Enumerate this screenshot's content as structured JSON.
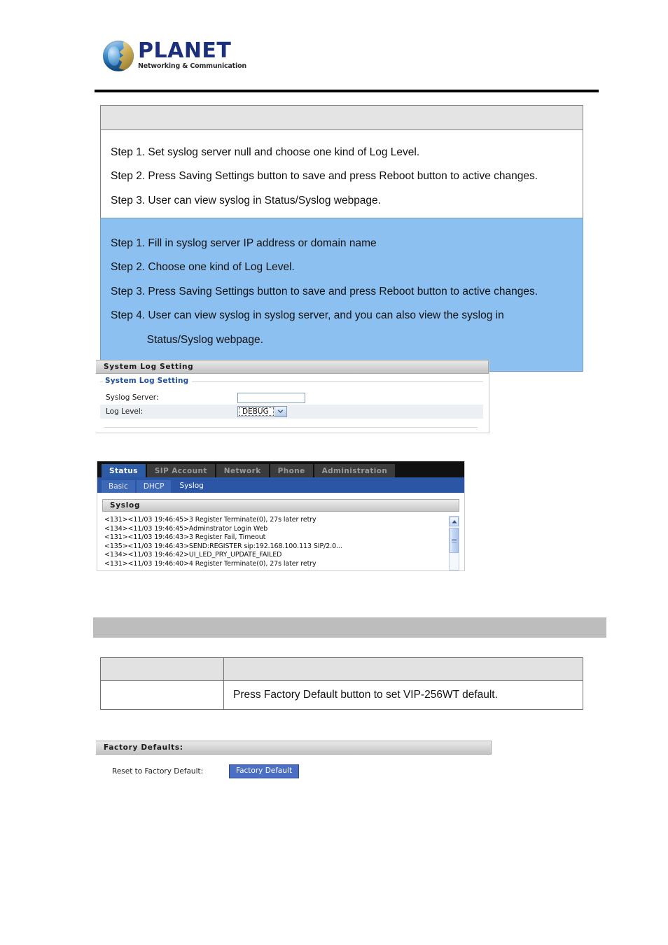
{
  "header": {
    "logo_word": "PLANET",
    "logo_tagline": "Networking & Communication"
  },
  "steps_box_1": {
    "header_label": "",
    "lines": [
      "Step 1. Set syslog server null and choose one kind of Log Level.",
      "Step 2. Press Saving Settings button to save and press Reboot button to active changes.",
      "Step 3. User can view syslog in Status/Syslog webpage."
    ]
  },
  "steps_box_2": {
    "lines": [
      "Step 1. Fill in syslog server IP address or domain name",
      "Step 2. Choose one kind of Log Level.",
      "Step 3. Press Saving Settings button to save and press Reboot button to active changes.",
      "Step 4. User can view syslog in syslog server, and you can also view the syslog in",
      "            Status/Syslog webpage."
    ]
  },
  "syslog_setting_panel": {
    "title": "System Log Setting",
    "legend": "System Log Setting",
    "fields": {
      "syslog_server_label": "Syslog Server:",
      "syslog_server_value": "",
      "syslog_server_placeholder": "",
      "log_level_label": "Log Level:",
      "log_level_value": "DEBUG"
    }
  },
  "status_shot": {
    "main_tabs": [
      {
        "label": "Status",
        "active": true
      },
      {
        "label": "SIP Account",
        "active": false
      },
      {
        "label": "Network",
        "active": false
      },
      {
        "label": "Phone",
        "active": false
      },
      {
        "label": "Administration",
        "active": false
      }
    ],
    "sub_tabs": [
      {
        "label": "Basic",
        "active": false
      },
      {
        "label": "DHCP",
        "active": false
      },
      {
        "label": "Syslog",
        "active": true
      }
    ],
    "panel_title": "Syslog",
    "log_lines": [
      "<131><11/03 19:46:45>3 Register Terminate(0), 27s later retry",
      "<134><11/03 19:46:45>Adminstrator Login Web",
      "<131><11/03 19:46:43>3 Register Fail, Timeout",
      "<135><11/03 19:46:43>SEND:REGISTER sip:192.168.100.113 SIP/2.0...",
      "<134><11/03 19:46:42>UI_LED_PRY_UPDATE_FAILED",
      "<131><11/03 19:46:40>4 Register Terminate(0), 27s later retry"
    ]
  },
  "factory_table": {
    "header_left": "",
    "header_right": "",
    "row_left": "",
    "row_right": "Press Factory Default button to set VIP-256WT default."
  },
  "factory_panel": {
    "title": "Factory Defaults:",
    "reset_label": "Reset to Factory Default:",
    "button_label": "Factory Default"
  },
  "colors": {
    "info_blue": "#8cc0f0",
    "band_gray": "#bdbdbd",
    "tab_active_blue": "#2e5ba6",
    "brand_blue": "#1b2f7a",
    "button_blue": "#4a6fc4"
  }
}
